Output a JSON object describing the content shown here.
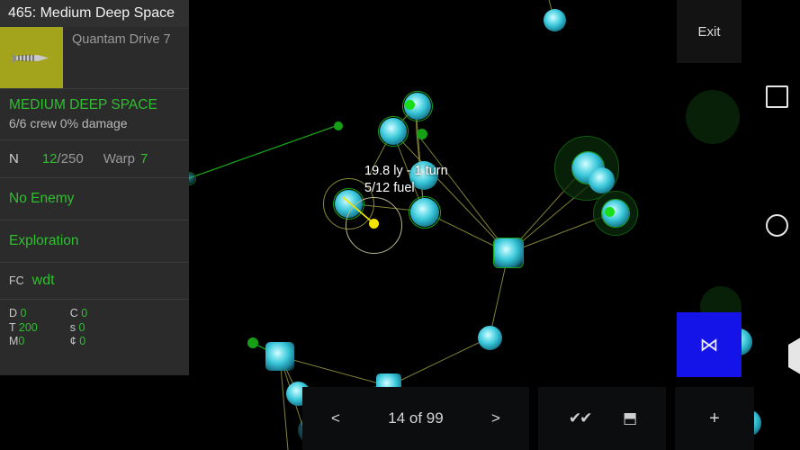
{
  "window": {
    "title": "465: Medium Deep Space"
  },
  "sidebar": {
    "ship": {
      "name": "Quantam Drive 7",
      "thumb_icon": "rocket-icon",
      "thumb_color": "#a4a41c"
    },
    "ship_class": {
      "class_label": "MEDIUM DEEP SPACE",
      "status_label": "6/6 crew  0% damage"
    },
    "nav": {
      "key": "N",
      "value": "12",
      "max": "/250",
      "warp_label": "Warp",
      "warp_value": "7"
    },
    "enemy": {
      "label": "No Enemy"
    },
    "mission": {
      "label": "Exploration"
    },
    "fc": {
      "key": "FC",
      "value": "wdt"
    },
    "stats": {
      "left": [
        {
          "key": "D",
          "value": "0"
        },
        {
          "key": "T",
          "value": "200"
        },
        {
          "key": "M",
          "value": "0"
        }
      ],
      "right": [
        {
          "key": "C",
          "value": "0"
        },
        {
          "key": "s",
          "value": "0"
        },
        {
          "key": "¢",
          "value": "0"
        }
      ]
    }
  },
  "map": {
    "hud_line1": "19.8 ly - 1 turn",
    "hud_line2": "5/12 fuel",
    "colors": {
      "star": "#37c5d8",
      "explored_ring": "#19a319",
      "route": "#8a8a3a",
      "selection": "#f2e400"
    }
  },
  "overlays": {
    "exit_label": "Exit",
    "blue_button_icon": "⋈"
  },
  "bottom_bar": {
    "pager": {
      "prev": "<",
      "page_text": "14 of 99",
      "next": ">"
    },
    "actions": {
      "confirm_icon": "✔✔",
      "split_icon": "⬒"
    },
    "plus": {
      "label": "+"
    }
  },
  "android_nav": {
    "recents": "square-icon",
    "home": "circle-icon",
    "back": "triangle-back-icon"
  }
}
